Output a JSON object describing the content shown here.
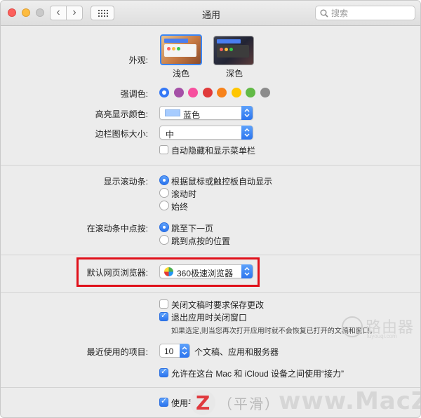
{
  "window": {
    "title": "通用",
    "search_placeholder": "搜索"
  },
  "appearance": {
    "label": "外观:",
    "options": [
      "浅色",
      "深色"
    ]
  },
  "accent": {
    "label": "强调色:",
    "colors": [
      "#3478f6",
      "#a550a7",
      "#f74f9e",
      "#e03a3a",
      "#f7821b",
      "#ffc600",
      "#62ba46",
      "#8c8c8c"
    ]
  },
  "highlight": {
    "label": "高亮显示颜色:",
    "value": "蓝色",
    "swatch_color": "#a7ccff"
  },
  "sidebar_icon": {
    "label": "边栏图标大小:",
    "value": "中"
  },
  "menubar": {
    "label": "自动隐藏和显示菜单栏"
  },
  "scrollbars": {
    "label": "显示滚动条:",
    "options": [
      "根据鼠标或触控板自动显示",
      "滚动时",
      "始终"
    ]
  },
  "click_scroll": {
    "label": "在滚动条中点按:",
    "options": [
      "跳至下一页",
      "跳到点按的位置"
    ]
  },
  "browser": {
    "label": "默认网页浏览器:",
    "value": "360极速浏览器"
  },
  "documents": {
    "ask_save": "关闭文稿时要求保存更改",
    "close_windows": "退出应用时关闭窗口",
    "note": "如果选定,则当您再次打开应用时就不会恢复已打开的文稿和窗口。"
  },
  "recent": {
    "label": "最近使用的项目:",
    "value": "10",
    "suffix": "个文稿、应用和服务器"
  },
  "handoff": {
    "label": "允许在这台 Mac 和 iCloud 设备之间使用“接力”"
  },
  "font_smoothing": {
    "label": "使用平滑..."
  },
  "watermarks": {
    "router_big": "路由器",
    "router_small": "luyouqi.com",
    "macz_logo": "Z",
    "macz_text": "www.MacZ.com",
    "macz_mid": "（平滑）"
  }
}
